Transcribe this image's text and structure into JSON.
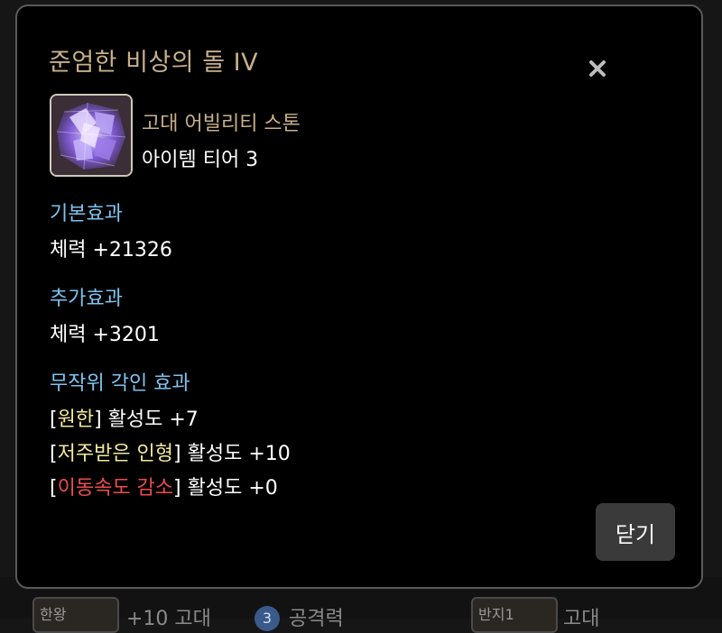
{
  "background": {
    "thumb_left_label": "한왕",
    "text_left": "+10 고대",
    "badge": "3",
    "text_mid": "공격력",
    "thumb_right_label": "반지1",
    "text_right": "고대"
  },
  "dialog": {
    "title": "준엄한 비상의 돌 IV",
    "item": {
      "icon": "amethyst-crystal-icon",
      "type": "고대 어빌리티 스톤",
      "tier": "아이템 티어 3"
    },
    "base_effect": {
      "heading": "기본효과",
      "line": "체력 +21326"
    },
    "extra_effect": {
      "heading": "추가효과",
      "line": "체력 +3201"
    },
    "random_engrave": {
      "heading": "무작위 각인 효과",
      "lines": [
        {
          "open": "[",
          "name": "원한",
          "close": "]",
          "value": " 활성도 +7"
        },
        {
          "open": "[",
          "name": "저주받은 인형",
          "close": "]",
          "value": " 활성도 +10"
        },
        {
          "open": "[",
          "name": "이동속도 감소",
          "close": "]",
          "value": " 활성도 +0"
        }
      ]
    },
    "close_button": "닫기",
    "colors": {
      "title": "#c8b08a",
      "heading": "#7ec3ef",
      "engrave_positive": "#f3ea9a",
      "engrave_negative": "#ef4b4b"
    }
  }
}
